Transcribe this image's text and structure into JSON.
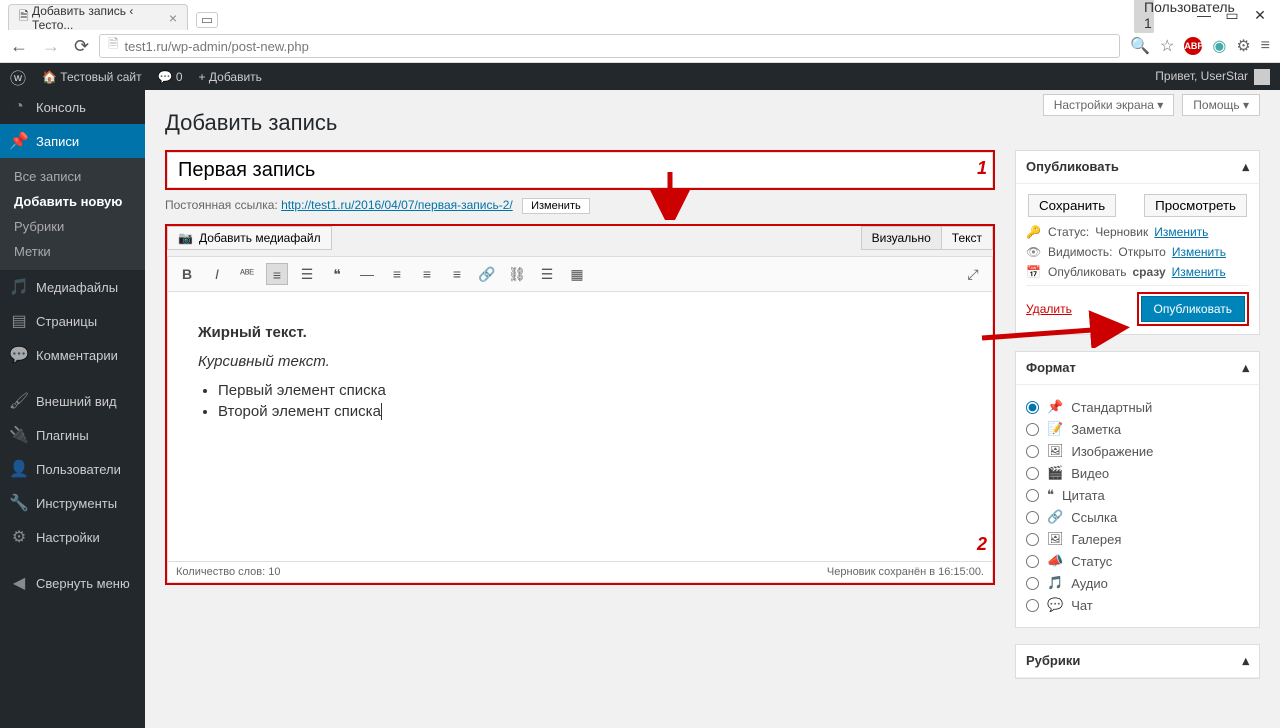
{
  "browser": {
    "tab_title": "Добавить запись ‹ Тесто...",
    "user_badge": "Пользователь 1",
    "url": "test1.ru/wp-admin/post-new.php"
  },
  "adminbar": {
    "site_name": "Тестовый сайт",
    "comments": "0",
    "add": "Добавить",
    "greeting": "Привет, UserStar"
  },
  "sidebar": {
    "items": [
      {
        "label": "Консоль"
      },
      {
        "label": "Записи"
      },
      {
        "label": "Медиафайлы"
      },
      {
        "label": "Страницы"
      },
      {
        "label": "Комментарии"
      },
      {
        "label": "Внешний вид"
      },
      {
        "label": "Плагины"
      },
      {
        "label": "Пользователи"
      },
      {
        "label": "Инструменты"
      },
      {
        "label": "Настройки"
      }
    ],
    "submenu": {
      "items": [
        "Все записи",
        "Добавить новую",
        "Рубрики",
        "Метки"
      ]
    },
    "collapse": "Свернуть меню"
  },
  "screen": {
    "options": "Настройки экрана",
    "help": "Помощь"
  },
  "page": {
    "title": "Добавить запись"
  },
  "post": {
    "title_value": "Первая запись",
    "permalink_label": "Постоянная ссылка:",
    "permalink_url": "http://test1.ru/2016/04/07/первая-запись-2/",
    "permalink_edit": "Изменить",
    "add_media": "Добавить медиафайл",
    "tab_visual": "Визуально",
    "tab_text": "Текст",
    "content_bold": "Жирный текст.",
    "content_italic": "Курсивный текст.",
    "li1": "Первый элемент списка",
    "li2": "Второй элемент списка",
    "wordcount_label": "Количество слов: 10",
    "saved": "Черновик сохранён в 16:15:00."
  },
  "publish": {
    "title": "Опубликовать",
    "save": "Сохранить",
    "preview": "Просмотреть",
    "status_label": "Статус:",
    "status_value": "Черновик",
    "visibility_label": "Видимость:",
    "visibility_value": "Открыто",
    "sched_label": "Опубликовать",
    "sched_value": "сразу",
    "edit": "Изменить",
    "delete": "Удалить",
    "submit": "Опубликовать"
  },
  "format": {
    "title": "Формат",
    "items": [
      "Стандартный",
      "Заметка",
      "Изображение",
      "Видео",
      "Цитата",
      "Ссылка",
      "Галерея",
      "Статус",
      "Аудио",
      "Чат"
    ]
  },
  "categories": {
    "title": "Рубрики"
  },
  "annotations": {
    "one": "1",
    "two": "2"
  }
}
